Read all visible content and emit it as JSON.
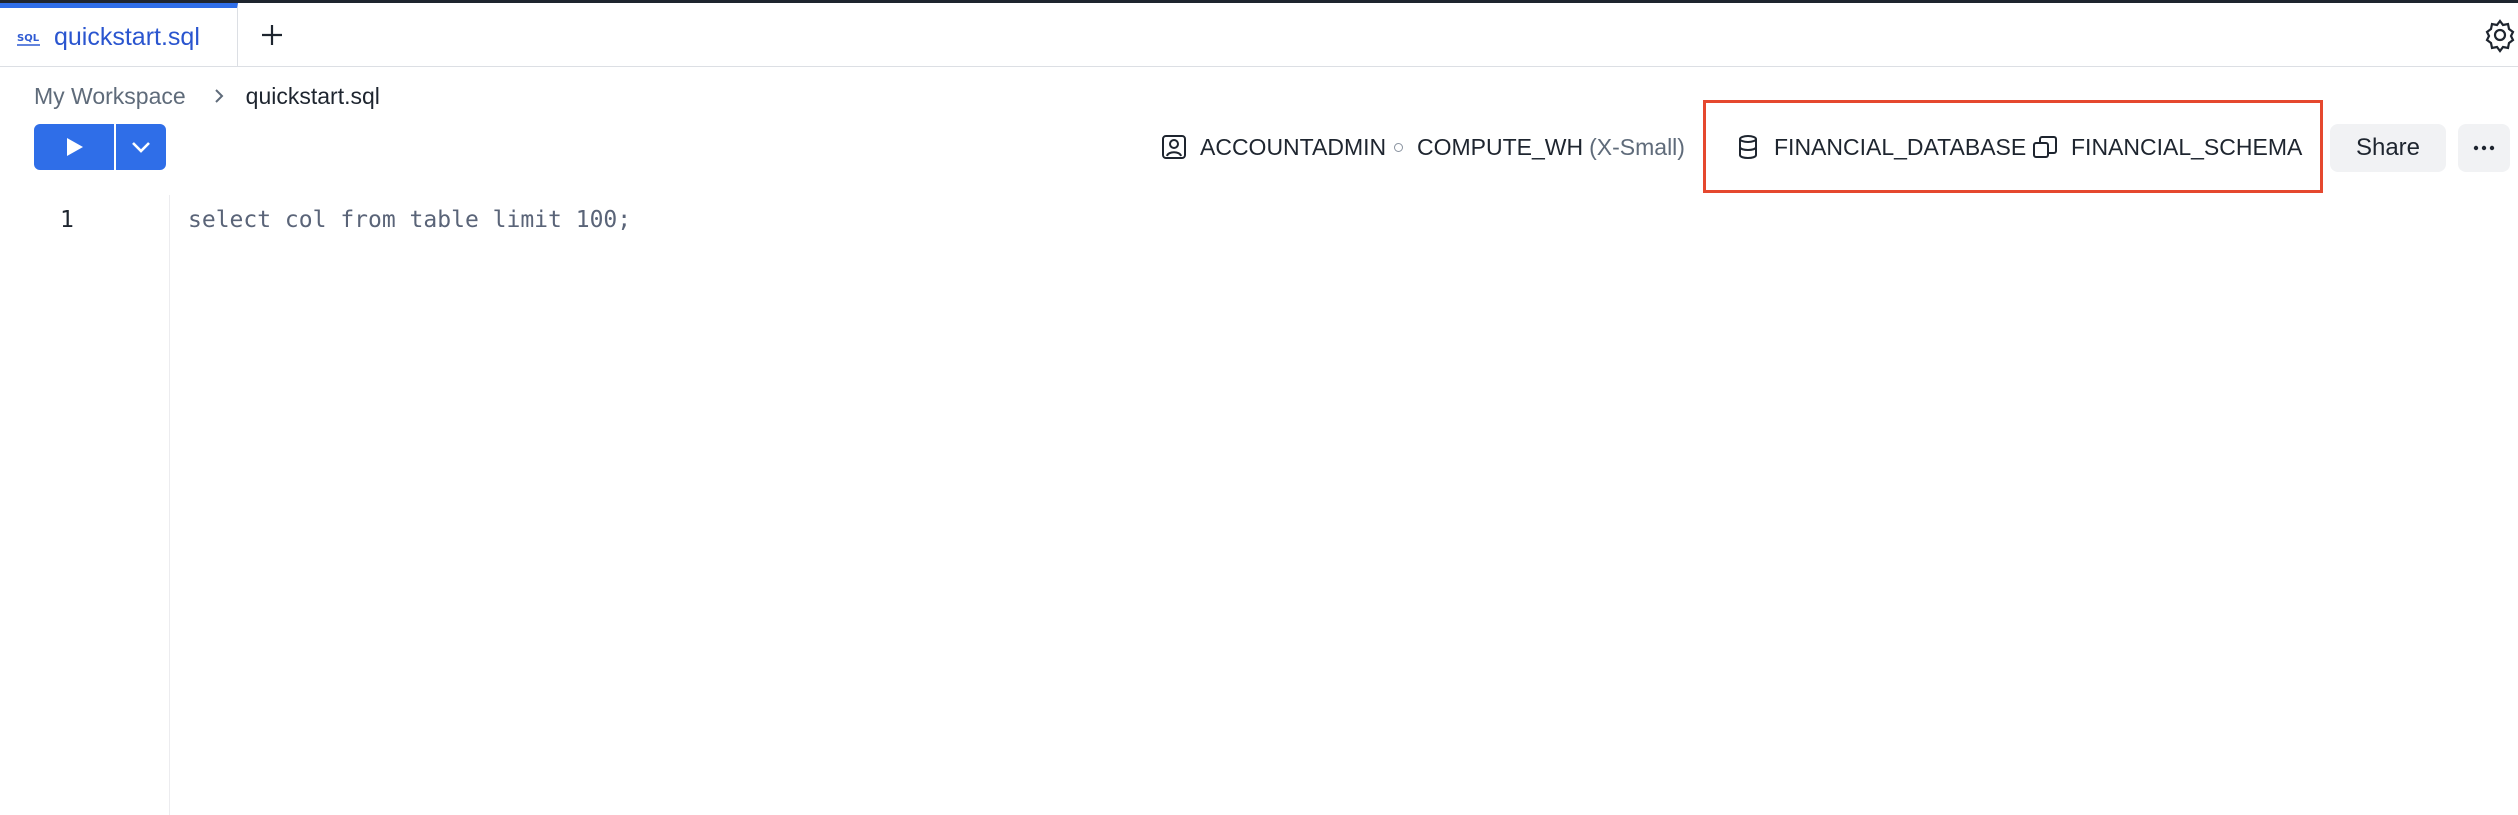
{
  "tabs": [
    {
      "label": "quickstart.sql",
      "icon": "sql-file-icon",
      "active": true
    }
  ],
  "breadcrumb": {
    "root": "My Workspace",
    "file": "quickstart.sql"
  },
  "toolbar": {
    "role": "ACCOUNTADMIN",
    "warehouse": "COMPUTE_WH",
    "warehouse_size": "(X-Small)",
    "database": "FINANCIAL_DATABASE",
    "schema": "FINANCIAL_SCHEMA",
    "share_label": "Share"
  },
  "editor": {
    "lines": [
      {
        "number": "1",
        "text": "select col from table limit 100;"
      }
    ]
  },
  "colors": {
    "accent": "#2f6ee8",
    "highlight": "#e5482f"
  }
}
